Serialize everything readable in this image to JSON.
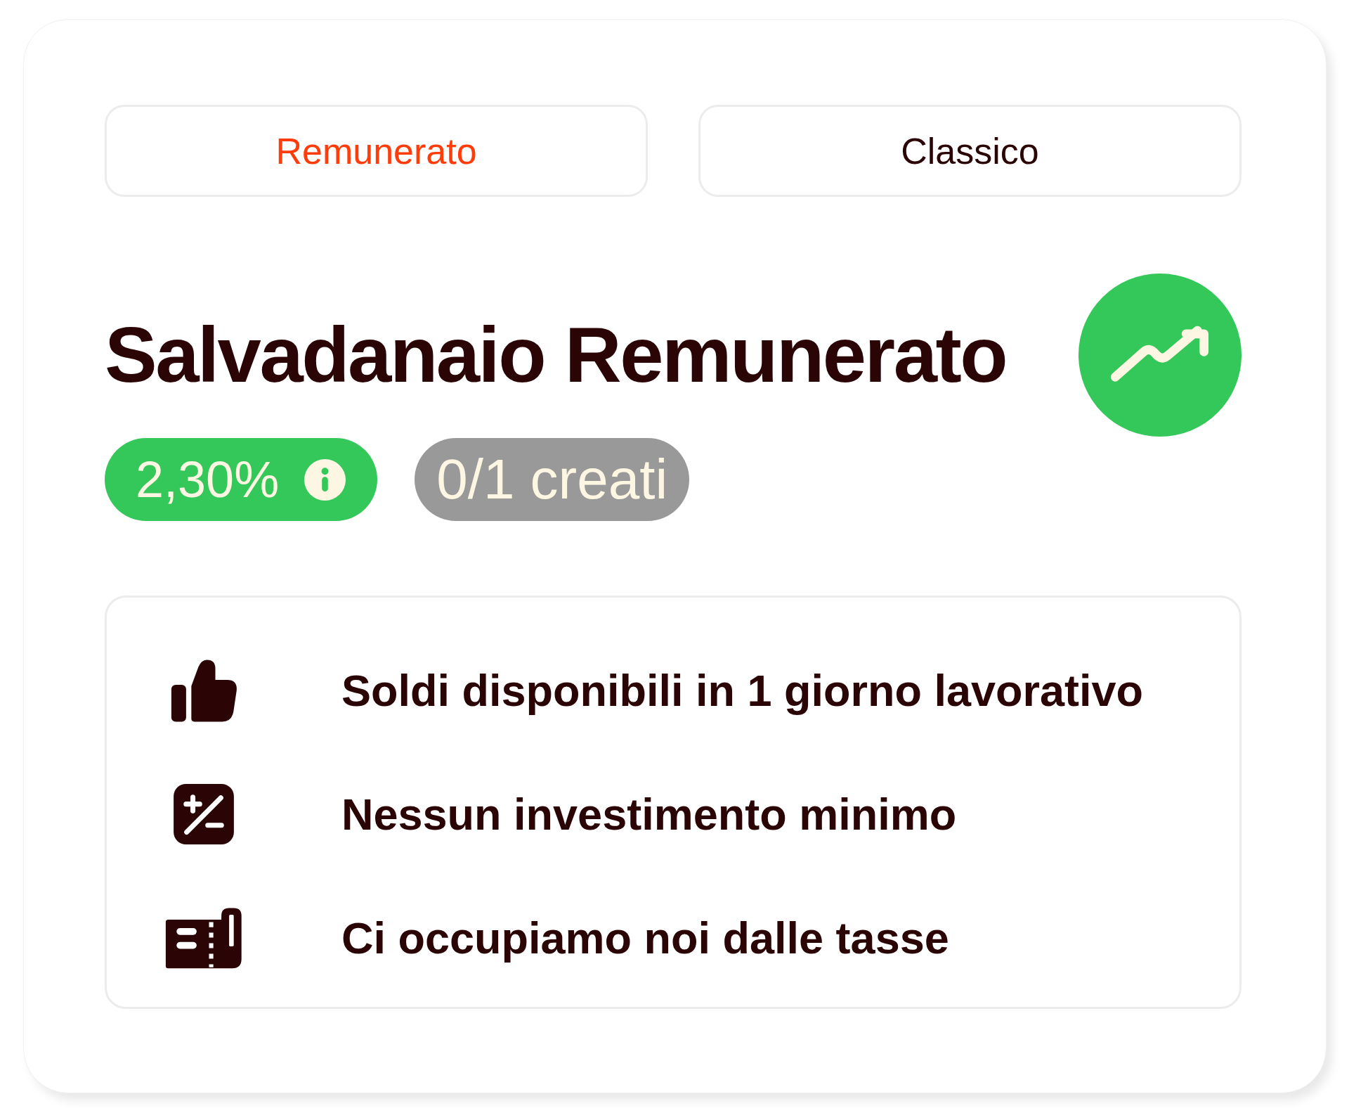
{
  "tabs": [
    {
      "label": "Remunerato",
      "selected": true
    },
    {
      "label": "Classico",
      "selected": false
    }
  ],
  "title": "Salvadanaio Remunerato",
  "badges": [
    {
      "kind": "rate",
      "text": "2,30%"
    },
    {
      "kind": "count",
      "text": "0/1 creati"
    }
  ],
  "features": [
    {
      "text": "Soldi disponibili in 1 giorno lavorativo"
    },
    {
      "text": "Nessun investimento minimo"
    },
    {
      "text": "Ci occupiamo noi dalle tasse"
    }
  ]
}
